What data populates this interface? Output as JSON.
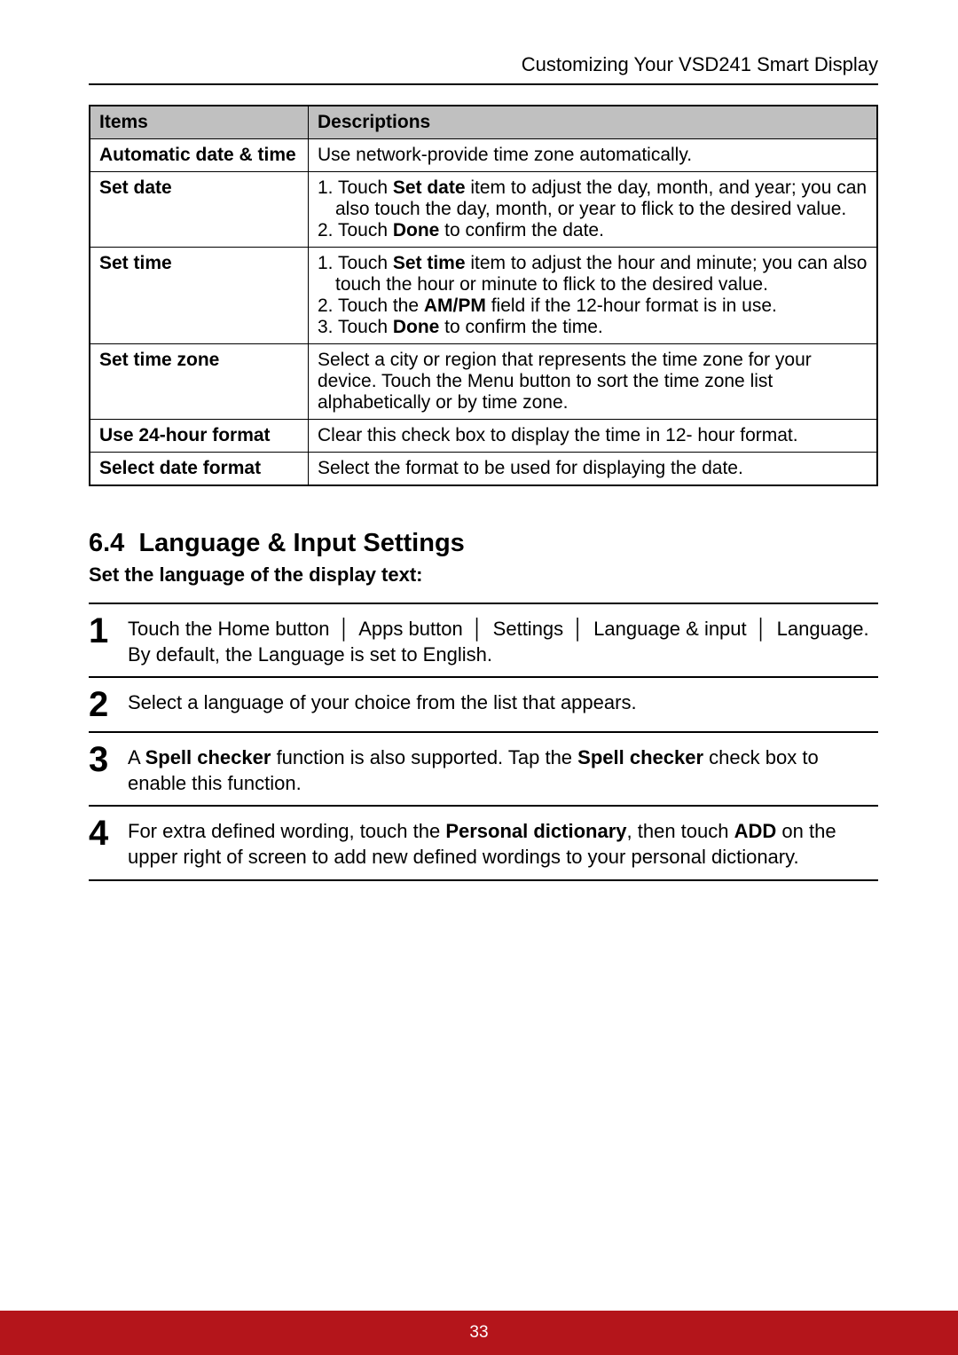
{
  "header": {
    "running": "Customizing Your VSD241 Smart Display"
  },
  "table": {
    "head": {
      "items": "Items",
      "desc": "Descriptions"
    },
    "rows": [
      {
        "item": "Automatic date & time",
        "desc_plain": "Use network-provide time zone automatically."
      },
      {
        "item": "Set date",
        "list": [
          {
            "n": "1. ",
            "pre": "Touch ",
            "bold": "Set date",
            "post": " item to adjust the day, month, and year; you can also touch the day, month, or year to flick to the desired value."
          },
          {
            "n": "2. ",
            "pre": "Touch ",
            "bold": "Done",
            "post": " to confirm the date."
          }
        ]
      },
      {
        "item": "Set time",
        "list": [
          {
            "n": "1. ",
            "pre": "Touch ",
            "bold": "Set time",
            "post": " item to adjust the hour and minute; you can also touch the hour or minute to flick to the desired value."
          },
          {
            "n": "2. ",
            "pre": "Touch the ",
            "bold": "AM/PM",
            "post": " field if the 12-hour format is in use."
          },
          {
            "n": "3. ",
            "pre": "Touch ",
            "bold": "Done",
            "post": " to confirm the time."
          }
        ]
      },
      {
        "item": "Set time zone",
        "desc_plain": "Select a city or region that represents the time zone for your device. Touch the Menu button to sort the time zone list alphabetically or by time zone."
      },
      {
        "item": "Use 24-hour format",
        "desc_plain": "Clear this check box to display the time in 12- hour format."
      },
      {
        "item": "Select date format",
        "desc_plain": "Select the format to be used for displaying the date."
      }
    ]
  },
  "section": {
    "number": "6.4",
    "title": "Language & Input Settings",
    "sub": "Set the language of the display text:"
  },
  "steps": {
    "s1": {
      "num": "1",
      "t1": "Touch the Home button ",
      "t2": " Apps button ",
      "t3": " Settings ",
      "t4": "Language & input ",
      "t5": " Language. By default, the Language is set to English.",
      "sep": "│"
    },
    "s2": {
      "num": "2",
      "text": "Select a language of your choice from the list that appears."
    },
    "s3": {
      "num": "3",
      "pre": "A ",
      "b1": "Spell checker",
      "mid": " function is also supported. Tap the ",
      "b2": "Spell checker",
      "post": " check box to enable this function."
    },
    "s4": {
      "num": "4",
      "pre": "For extra defined wording, touch the ",
      "b1": "Personal dictionary",
      "mid": ", then touch ",
      "b2": "ADD",
      "post": " on the upper right of screen to add new defined wordings to your personal dictionary."
    }
  },
  "footer": {
    "page": "33"
  }
}
